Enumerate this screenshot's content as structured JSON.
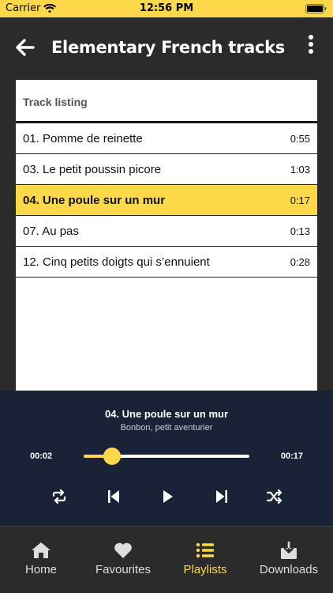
{
  "status_bar": {
    "carrier": "Carrier",
    "time": "12:56 PM"
  },
  "header": {
    "title": "Elementary French tracks"
  },
  "track_list": {
    "heading": "Track listing",
    "tracks": [
      {
        "name": "01. Pomme de reinette",
        "duration": "0:55",
        "active": false
      },
      {
        "name": "03. Le petit poussin picore",
        "duration": "1:03",
        "active": false
      },
      {
        "name": "04. Une poule sur un mur",
        "duration": "0:17",
        "active": true
      },
      {
        "name": "07. Au pas",
        "duration": "0:13",
        "active": false
      },
      {
        "name": "12. Cinq petits doigts qui s’ennuient",
        "duration": "0:28",
        "active": false
      }
    ]
  },
  "player": {
    "title": "04. Une poule sur un mur",
    "artist": "Bonbon, petit aventurier",
    "elapsed": "00:02",
    "total": "00:17",
    "progress": 0.17,
    "controls": [
      "repeat-icon",
      "previous-icon",
      "play-icon",
      "next-icon",
      "shuffle-icon"
    ]
  },
  "tabs": [
    {
      "label": "Home",
      "icon": "home-icon",
      "active": false
    },
    {
      "label": "Favourites",
      "icon": "heart-icon",
      "active": false
    },
    {
      "label": "Playlists",
      "icon": "list-icon",
      "active": true
    },
    {
      "label": "Downloads",
      "icon": "download-icon",
      "active": false
    }
  ],
  "colors": {
    "accent": "#fdd94a",
    "header_bg": "#2b2b2b",
    "player_bg": "#1a2238",
    "card_bg": "#ffffff"
  }
}
